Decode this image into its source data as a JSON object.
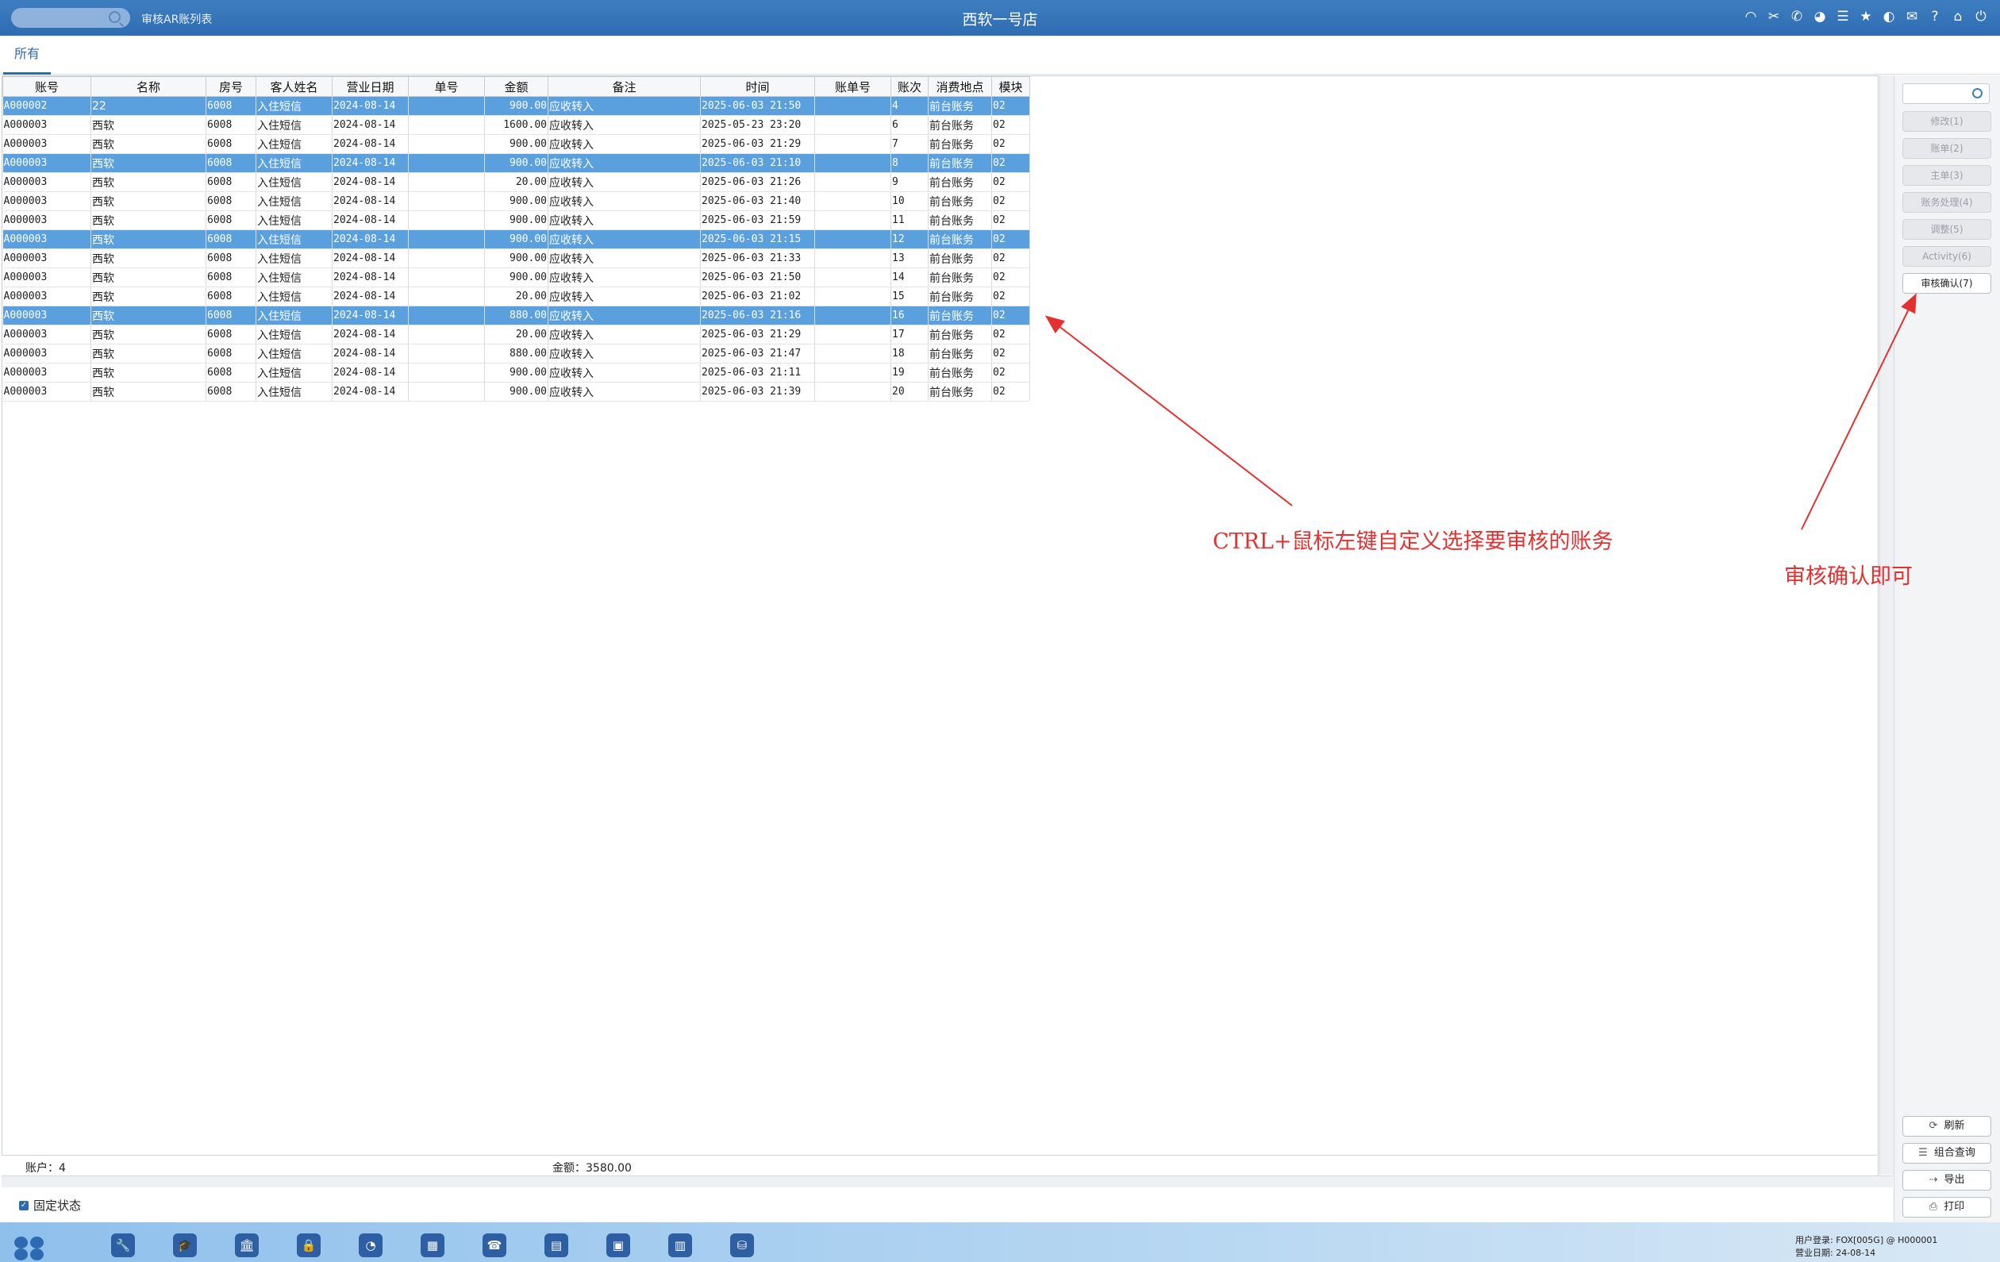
{
  "titlebar": {
    "page_title": "审核AR账列表",
    "app_title": "西软一号店",
    "icons": [
      "wifi-icon",
      "tools-icon",
      "phone-icon",
      "palette-icon",
      "menu-icon",
      "star-icon",
      "contrast-icon",
      "mail-icon",
      "help-icon",
      "home-icon",
      "power-icon"
    ]
  },
  "tabs": [
    {
      "label": "所有"
    }
  ],
  "table": {
    "columns": [
      "账号",
      "名称",
      "房号",
      "客人姓名",
      "营业日期",
      "单号",
      "金额",
      "备注",
      "时间",
      "账单号",
      "账次",
      "消费地点",
      "模块"
    ],
    "rows": [
      {
        "selected": true,
        "cells": [
          "A000002",
          "22",
          "6008",
          "入住短信",
          "2024-08-14",
          "",
          "900.00",
          "应收转入",
          "2025-06-03 21:50",
          "",
          "4",
          "前台账务",
          "02"
        ]
      },
      {
        "selected": false,
        "cells": [
          "A000003",
          "西软",
          "6008",
          "入住短信",
          "2024-08-14",
          "",
          "1600.00",
          "应收转入",
          "2025-05-23 23:20",
          "",
          "6",
          "前台账务",
          "02"
        ]
      },
      {
        "selected": false,
        "cells": [
          "A000003",
          "西软",
          "6008",
          "入住短信",
          "2024-08-14",
          "",
          "900.00",
          "应收转入",
          "2025-06-03 21:29",
          "",
          "7",
          "前台账务",
          "02"
        ]
      },
      {
        "selected": true,
        "cells": [
          "A000003",
          "西软",
          "6008",
          "入住短信",
          "2024-08-14",
          "",
          "900.00",
          "应收转入",
          "2025-06-03 21:10",
          "",
          "8",
          "前台账务",
          "02"
        ]
      },
      {
        "selected": false,
        "cells": [
          "A000003",
          "西软",
          "6008",
          "入住短信",
          "2024-08-14",
          "",
          "20.00",
          "应收转入",
          "2025-06-03 21:26",
          "",
          "9",
          "前台账务",
          "02"
        ]
      },
      {
        "selected": false,
        "cells": [
          "A000003",
          "西软",
          "6008",
          "入住短信",
          "2024-08-14",
          "",
          "900.00",
          "应收转入",
          "2025-06-03 21:40",
          "",
          "10",
          "前台账务",
          "02"
        ]
      },
      {
        "selected": false,
        "cells": [
          "A000003",
          "西软",
          "6008",
          "入住短信",
          "2024-08-14",
          "",
          "900.00",
          "应收转入",
          "2025-06-03 21:59",
          "",
          "11",
          "前台账务",
          "02"
        ]
      },
      {
        "selected": true,
        "cells": [
          "A000003",
          "西软",
          "6008",
          "入住短信",
          "2024-08-14",
          "",
          "900.00",
          "应收转入",
          "2025-06-03 21:15",
          "",
          "12",
          "前台账务",
          "02"
        ]
      },
      {
        "selected": false,
        "cells": [
          "A000003",
          "西软",
          "6008",
          "入住短信",
          "2024-08-14",
          "",
          "900.00",
          "应收转入",
          "2025-06-03 21:33",
          "",
          "13",
          "前台账务",
          "02"
        ]
      },
      {
        "selected": false,
        "cells": [
          "A000003",
          "西软",
          "6008",
          "入住短信",
          "2024-08-14",
          "",
          "900.00",
          "应收转入",
          "2025-06-03 21:50",
          "",
          "14",
          "前台账务",
          "02"
        ]
      },
      {
        "selected": false,
        "cells": [
          "A000003",
          "西软",
          "6008",
          "入住短信",
          "2024-08-14",
          "",
          "20.00",
          "应收转入",
          "2025-06-03 21:02",
          "",
          "15",
          "前台账务",
          "02"
        ]
      },
      {
        "selected": true,
        "cells": [
          "A000003",
          "西软",
          "6008",
          "入住短信",
          "2024-08-14",
          "",
          "880.00",
          "应收转入",
          "2025-06-03 21:16",
          "",
          "16",
          "前台账务",
          "02"
        ]
      },
      {
        "selected": false,
        "cells": [
          "A000003",
          "西软",
          "6008",
          "入住短信",
          "2024-08-14",
          "",
          "20.00",
          "应收转入",
          "2025-06-03 21:29",
          "",
          "17",
          "前台账务",
          "02"
        ]
      },
      {
        "selected": false,
        "cells": [
          "A000003",
          "西软",
          "6008",
          "入住短信",
          "2024-08-14",
          "",
          "880.00",
          "应收转入",
          "2025-06-03 21:47",
          "",
          "18",
          "前台账务",
          "02"
        ]
      },
      {
        "selected": false,
        "cells": [
          "A000003",
          "西软",
          "6008",
          "入住短信",
          "2024-08-14",
          "",
          "900.00",
          "应收转入",
          "2025-06-03 21:11",
          "",
          "19",
          "前台账务",
          "02"
        ]
      },
      {
        "selected": false,
        "cells": [
          "A000003",
          "西软",
          "6008",
          "入住短信",
          "2024-08-14",
          "",
          "900.00",
          "应收转入",
          "2025-06-03 21:39",
          "",
          "20",
          "前台账务",
          "02"
        ]
      }
    ]
  },
  "summary": {
    "accounts": "账户：4",
    "amount": "金额：3580.00"
  },
  "fixed_status": "固定状态",
  "right_panel": {
    "buttons": [
      "修改(1)",
      "账单(2)",
      "主单(3)",
      "账务处理(4)",
      "调整(5)",
      "Activity(6)",
      "审核确认(7)"
    ],
    "bottom_buttons": [
      {
        "label": "刷新",
        "icon": "refresh-icon",
        "glyph": "⟳"
      },
      {
        "label": "组合查询",
        "icon": "list-icon",
        "glyph": "☰"
      },
      {
        "label": "导出",
        "icon": "export-icon",
        "glyph": "⇢"
      },
      {
        "label": "打印",
        "icon": "print-icon",
        "glyph": "⎙"
      }
    ]
  },
  "taskbar": {
    "apps": [
      "wrench-icon",
      "graduation-icon",
      "bank-icon",
      "lock-icon",
      "chart-icon",
      "calculator-icon",
      "support-icon",
      "id-card-icon",
      "contact-card-icon",
      "report-icon",
      "database-icon"
    ],
    "user_line": "用户登录:  FOX[005G] @ H000001",
    "date_line": "营业日期:  24-08-14"
  },
  "annotations": {
    "select_hint": "CTRL+鼠标左键自定义选择要审核的账务",
    "confirm_hint": "审核确认即可",
    "color": "#e53030"
  }
}
